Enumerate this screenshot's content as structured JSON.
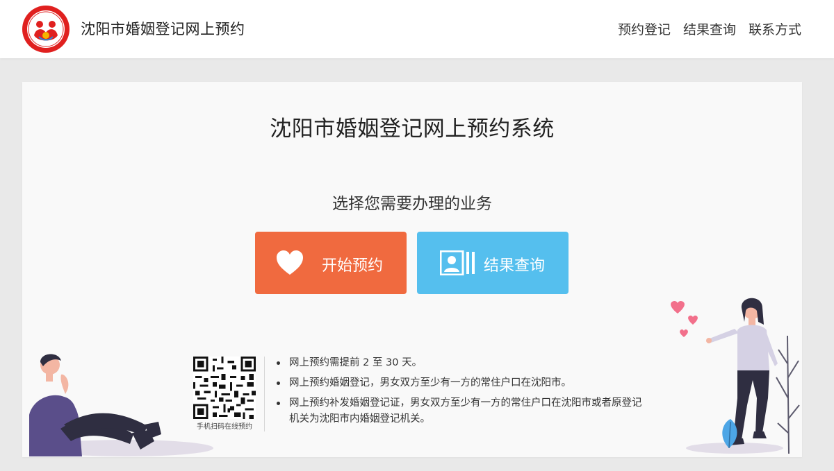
{
  "header": {
    "logo_text": "婚姻登记",
    "site_title": "沈阳市婚姻登记网上预约",
    "nav": [
      {
        "label": "预约登记"
      },
      {
        "label": "结果查询"
      },
      {
        "label": "联系方式"
      }
    ]
  },
  "main": {
    "title": "沈阳市婚姻登记网上预约系统",
    "subtitle": "选择您需要办理的业务",
    "buttons": {
      "start": {
        "label": "开始预约",
        "icon": "heart-icon",
        "color": "#f06a3f"
      },
      "query": {
        "label": "结果查询",
        "icon": "id-card-icon",
        "color": "#55bfee"
      }
    },
    "qr_caption": "手机扫码在线预约",
    "notes": [
      "网上预约需提前 2 至 30 天。",
      "网上预约婚姻登记，男女双方至少有一方的常住户口在沈阳市。",
      "网上预约补发婚姻登记证，男女双方至少有一方的常住户口在沈阳市或者原登记机关为沈阳市内婚姻登记机关。"
    ]
  },
  "colors": {
    "accent_orange": "#f06a3f",
    "accent_blue": "#55bfee",
    "logo_red": "#e0201f"
  }
}
